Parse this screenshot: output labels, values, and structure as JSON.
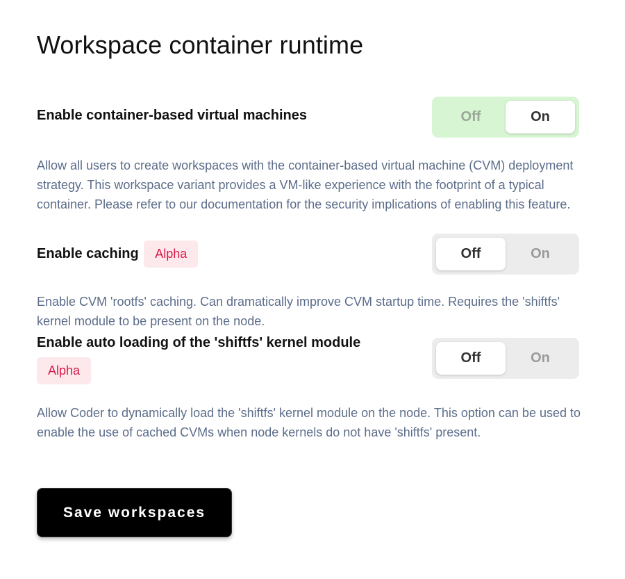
{
  "page": {
    "title": "Workspace container runtime"
  },
  "settings": [
    {
      "label": "Enable container-based virtual machines",
      "badge": "",
      "description": "Allow all users to create workspaces with the container-based virtual machine (CVM) deployment strategy. This workspace variant provides a VM-like experience with the footprint of a typical container. Please refer to our documentation for the security implications of enabling this feature.",
      "toggle": {
        "off_label": "Off",
        "on_label": "On",
        "value": "On"
      }
    },
    {
      "label": "Enable caching",
      "badge": "Alpha",
      "description": "Enable CVM 'rootfs' caching. Can dramatically improve CVM startup time. Requires the 'shiftfs' kernel module to be present on the node.",
      "toggle": {
        "off_label": "Off",
        "on_label": "On",
        "value": "Off"
      }
    },
    {
      "label": "Enable auto loading of the 'shiftfs' kernel module",
      "badge": "Alpha",
      "description": "Allow Coder to dynamically load the 'shiftfs' kernel module on the node. This option can be used to enable the use of cached CVMs when node kernels do not have 'shiftfs' present.",
      "toggle": {
        "off_label": "Off",
        "on_label": "On",
        "value": "Off"
      }
    }
  ],
  "actions": {
    "save_label": "Save workspaces"
  },
  "colors": {
    "toggle_on_bg": "#d7f5d3",
    "toggle_off_bg": "#ececec",
    "badge_bg": "#fde8ec",
    "badge_text": "#d81b48",
    "description_text": "#5c6d8a",
    "button_bg": "#000000"
  }
}
